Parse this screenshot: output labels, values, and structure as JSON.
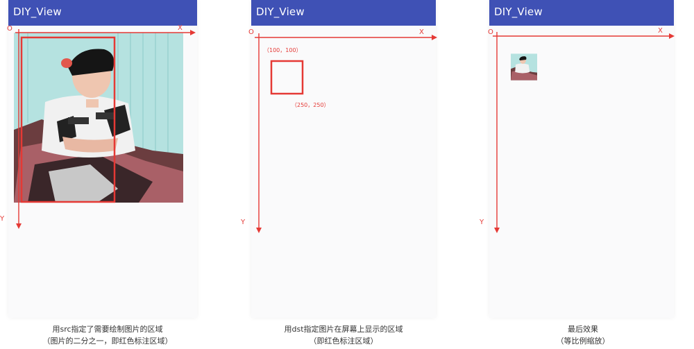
{
  "app_title": "DIY_View",
  "axes": {
    "origin": "O",
    "x": "X",
    "y": "Y"
  },
  "panels": [
    {
      "id": "src",
      "caption_line1": "用src指定了需要绘制图片的区域",
      "caption_line2": "（图片的二分之一，即红色标注区域）"
    },
    {
      "id": "dst",
      "point_start": "（100，100）",
      "point_end": "（250，250）",
      "caption_line1": "用dst指定图片在屏幕上显示的区域",
      "caption_line2": "（即红色标注区域）"
    },
    {
      "id": "result",
      "caption_line1": "最后效果",
      "caption_line2": "（等比例缩放）"
    }
  ],
  "colors": {
    "app_bar": "#3f51b5",
    "annotation_red": "#e53935"
  }
}
